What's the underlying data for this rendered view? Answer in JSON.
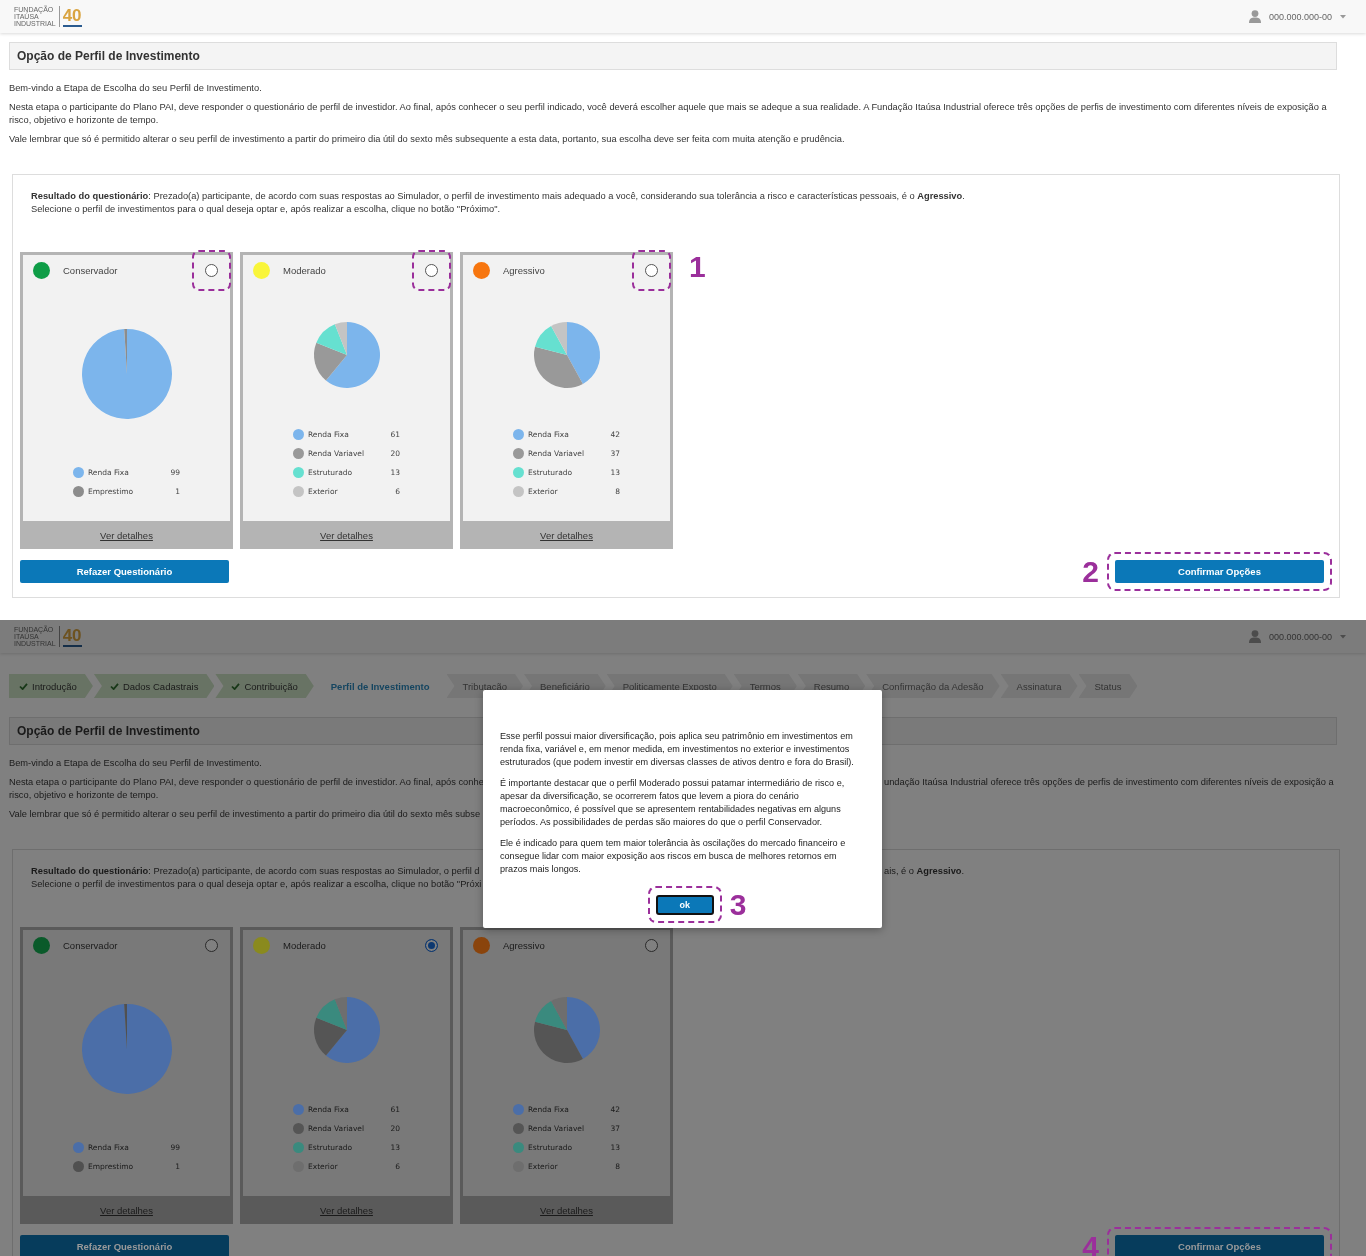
{
  "screens": [
    {
      "dimmed": false,
      "header": {
        "logo_lines": [
          "FUNDAÇÃO",
          "ITAÚSA",
          "INDUSTRIAL"
        ],
        "logo_badge": "40",
        "user": "000.000.000-00"
      },
      "title": "Opção de Perfil de Investimento",
      "intro": [
        "Bem-vindo a Etapa de Escolha do seu Perfil de Investimento.",
        "Nesta etapa o participante do Plano PAI, deve responder o questionário de perfil de investidor. Ao final, após conhecer o seu perfil indicado, você deverá escolher aquele que mais se adeque a sua realidade. A Fundação Itaúsa Industrial oferece três opções de perfis de investimento com diferentes níveis de exposição a risco, objetivo e horizonte de tempo.",
        "Vale lembrar que só é permitido alterar o seu perfil de investimento a partir do primeiro dia útil do sexto mês subsequente a esta data, portanto, sua escolha deve ser feita com muita atenção e prudência."
      ],
      "result_lines": [
        {
          "left": "**Resultado do questionário**: Prezado(a) participante, de acordo com suas respostas ao Simulador, o perfil de investimento mais adequado a você, considerando sua tolerância a risco e características pessoais, é o **Agressivo**."
        },
        {
          "left": "Selecione o perfil de investimentos para o qual deseja optar e, após realizar a escolha, clique no botão \"Próximo\"."
        }
      ],
      "cards": [
        {
          "name": "Conservador",
          "color": "#0f9d47",
          "selected": false,
          "highlighted": true,
          "link": "Ver detalhes",
          "legend": [
            {
              "label": "Renda Fixa",
              "value": "99",
              "color": "#7cb5ec"
            },
            {
              "label": "Emprestimo",
              "value": "1",
              "color": "#8c8c8c"
            }
          ],
          "chart_data": {
            "type": "pie",
            "values": [
              99,
              1
            ]
          }
        },
        {
          "name": "Moderado",
          "color": "#f9f53a",
          "selected": false,
          "highlighted": true,
          "link": "Ver detalhes",
          "legend": [
            {
              "label": "Renda Fixa",
              "value": "61",
              "color": "#7cb5ec"
            },
            {
              "label": "Renda Variavel",
              "value": "20",
              "color": "#999999"
            },
            {
              "label": "Estruturado",
              "value": "13",
              "color": "#66e0d0"
            },
            {
              "label": "Exterior",
              "value": "6",
              "color": "#c4c4c4"
            }
          ],
          "chart_data": {
            "type": "pie",
            "values": [
              61,
              20,
              13,
              6
            ]
          }
        },
        {
          "name": "Agressivo",
          "color": "#f7760f",
          "selected": false,
          "highlighted": true,
          "link": "Ver detalhes",
          "legend": [
            {
              "label": "Renda Fixa",
              "value": "42",
              "color": "#7cb5ec"
            },
            {
              "label": "Renda Variavel",
              "value": "37",
              "color": "#999999"
            },
            {
              "label": "Estruturado",
              "value": "13",
              "color": "#66e0d0"
            },
            {
              "label": "Exterior",
              "value": "8",
              "color": "#c4c4c4"
            }
          ],
          "chart_data": {
            "type": "pie",
            "values": [
              42,
              37,
              13,
              8
            ]
          }
        }
      ],
      "cards_marker": "1",
      "redo_button": {
        "label": "Refazer Questionário"
      },
      "confirm_button": {
        "label": "Confirmar Opções",
        "highlighted": true,
        "marker": "2"
      }
    },
    {
      "dimmed": true,
      "header": {
        "logo_lines": [
          "FUNDAÇÃO",
          "ITAÚSA",
          "INDUSTRIAL"
        ],
        "logo_badge": "40",
        "user": "000.000.000-00"
      },
      "steps": [
        {
          "label": "Introdução",
          "done": true,
          "selected": false
        },
        {
          "label": "Dados Cadastrais",
          "done": true,
          "selected": false
        },
        {
          "label": "Contribuição",
          "done": true,
          "selected": false
        },
        {
          "label": "Perfil de Investimento",
          "done": false,
          "selected": true
        },
        {
          "label": "Tributação",
          "done": false,
          "selected": false
        },
        {
          "label": "Beneficiário",
          "done": false,
          "selected": false
        },
        {
          "label": "Politicamente Exposto",
          "done": false,
          "selected": false
        },
        {
          "label": "Termos",
          "done": false,
          "selected": false
        },
        {
          "label": "Resumo",
          "done": false,
          "selected": false
        },
        {
          "label": "Confirmação da Adesão",
          "done": false,
          "selected": false
        },
        {
          "label": "Assinatura",
          "done": false,
          "selected": false
        },
        {
          "label": "Status",
          "done": false,
          "selected": false
        }
      ],
      "title": "Opção de Perfil de Investimento",
      "intro_lines": [
        [
          {
            "left": "Bem-vindo a Etapa de Escolha do seu Perfil de Investimento."
          }
        ],
        [
          {
            "left": "Nesta etapa o participante do Plano PAI, deve responder o questionário de perfil de investidor. Ao final, após conhe",
            "right": "undação Itaúsa Industrial oferece três opções de perfis de investimento com diferentes níveis de exposição a"
          },
          {
            "left": "risco, objetivo e horizonte de tempo."
          }
        ],
        [
          {
            "left": "Vale lembrar que só é permitido alterar o seu perfil de investimento a partir do primeiro dia útil do sexto mês subse"
          }
        ]
      ],
      "result_lines": [
        {
          "left": "**Resultado do questionário**: Prezado(a) participante, de acordo com suas respostas ao Simulador, o perfil d",
          "right": "ais, é o **Agressivo**."
        },
        {
          "left": "Selecione o perfil de investimentos para o qual deseja optar e, após realizar a escolha, clique no botão \"Próxi"
        }
      ],
      "cards": [
        {
          "name": "Conservador",
          "color": "#0a5a2a",
          "selected": false,
          "link": "Ver detalhes",
          "legend": [
            {
              "label": "Renda Fixa",
              "value": "99",
              "color": "#4b6ea8"
            },
            {
              "label": "Emprestimo",
              "value": "1",
              "color": "#505050"
            }
          ],
          "chart_data": {
            "type": "pie",
            "values": [
              99,
              1
            ]
          }
        },
        {
          "name": "Moderado",
          "color": "#8a8a1e",
          "selected": true,
          "link": "Ver detalhes",
          "legend": [
            {
              "label": "Renda Fixa",
              "value": "61",
              "color": "#4b6ea8"
            },
            {
              "label": "Renda Variavel",
              "value": "20",
              "color": "#555555"
            },
            {
              "label": "Estruturado",
              "value": "13",
              "color": "#3a8a7e"
            },
            {
              "label": "Exterior",
              "value": "6",
              "color": "#6e6e6e"
            }
          ],
          "chart_data": {
            "type": "pie",
            "values": [
              61,
              20,
              13,
              6
            ]
          }
        },
        {
          "name": "Agressivo",
          "color": "#8a440c",
          "selected": false,
          "link": "Ver detalhes",
          "legend": [
            {
              "label": "Renda Fixa",
              "value": "42",
              "color": "#4b6ea8"
            },
            {
              "label": "Renda Variavel",
              "value": "37",
              "color": "#555555"
            },
            {
              "label": "Estruturado",
              "value": "13",
              "color": "#3a8a7e"
            },
            {
              "label": "Exterior",
              "value": "8",
              "color": "#6e6e6e"
            }
          ],
          "chart_data": {
            "type": "pie",
            "values": [
              42,
              37,
              13,
              8
            ]
          }
        }
      ],
      "redo_button": {
        "label": "Refazer Questionário"
      },
      "confirm_button": {
        "label": "Confirmar Opções",
        "highlighted": true,
        "marker": "4"
      },
      "modal": {
        "paragraphs": [
          "Esse perfil possui maior diversificação, pois aplica seu patrimônio em investimentos em renda fixa, variável e, em menor medida, em investimentos no exterior e investimentos estruturados (que podem investir em diversas classes de ativos dentro e fora do Brasil).",
          "É importante destacar que o perfil Moderado possui patamar intermediário de risco e, apesar da diversificação, se ocorrerem fatos que levem a piora do cenário macroeconômico, é possível que se apresentem rentabilidades negativas em alguns períodos. As possibilidades de perdas são maiores do que o perfil Conservador.",
          "Ele é indicado para quem tem maior tolerância às oscilações do mercado financeiro e consegue lidar com maior exposição aos riscos em busca de melhores retornos em prazos mais longos."
        ],
        "ok_button": {
          "label": "ok",
          "highlighted": true,
          "marker": "3"
        }
      }
    }
  ]
}
